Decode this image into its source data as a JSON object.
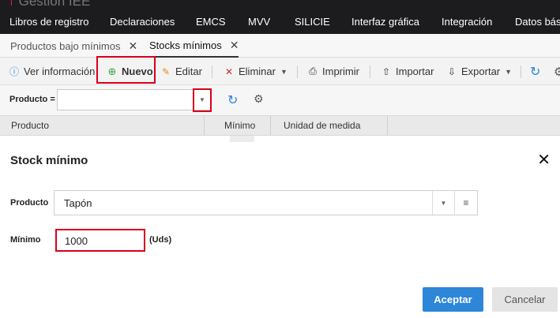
{
  "topnav": {
    "brand": "Gestión IEE",
    "items": [
      "Libros de registro",
      "Declaraciones",
      "EMCS",
      "MVV",
      "SILICIE",
      "Interfaz gráfica",
      "Integración",
      "Datos básicos"
    ]
  },
  "tabs": [
    {
      "label": "Productos bajo mínimos",
      "active": false
    },
    {
      "label": "Stocks mínimos",
      "active": true
    }
  ],
  "toolbar": {
    "info": "Ver información",
    "new": "Nuevo",
    "edit": "Editar",
    "delete": "Eliminar",
    "print": "Imprimir",
    "import": "Importar",
    "export": "Exportar"
  },
  "filter": {
    "label": "Producto =",
    "value": ""
  },
  "grid": {
    "columns": [
      "Producto",
      "Mínimo",
      "Unidad de medida"
    ]
  },
  "modal": {
    "title": "Stock mínimo",
    "product_label": "Producto",
    "product_value": "Tapón",
    "minimum_label": "Mínimo",
    "minimum_value": "1000",
    "unit": "(Uds)",
    "accept": "Aceptar",
    "cancel": "Cancelar"
  },
  "colors": {
    "topbar": "#1c1c1e",
    "highlight": "#d9001b",
    "primary": "#2d86d8",
    "new_icon": "#3aa53a",
    "edit_icon": "#e08a1e",
    "delete_icon": "#d02b2b",
    "info_icon": "#2d86d8"
  }
}
